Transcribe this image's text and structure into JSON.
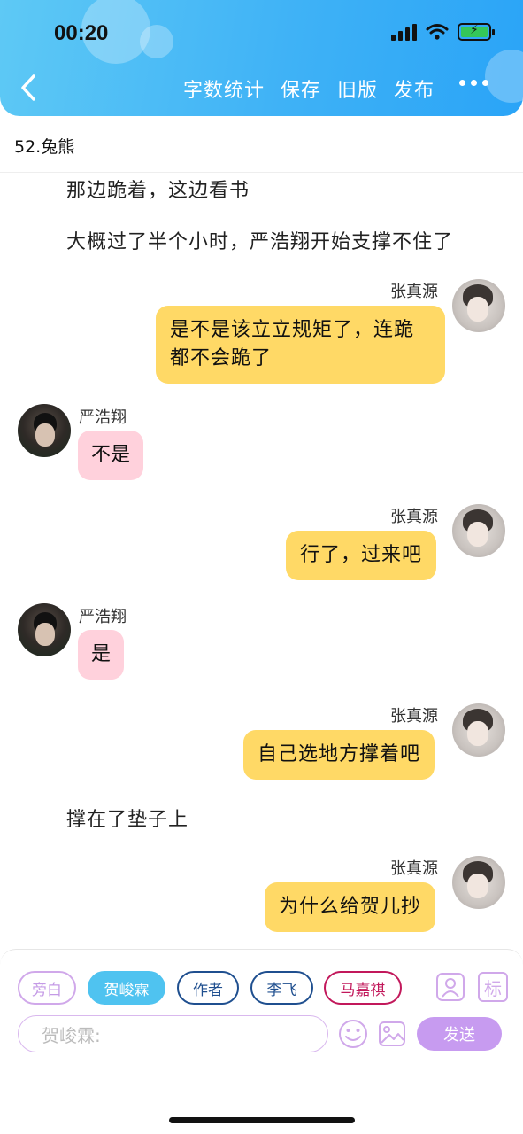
{
  "status": {
    "time": "00:20"
  },
  "header": {
    "actions": [
      "字数统计",
      "保存",
      "旧版",
      "发布"
    ]
  },
  "chapter": {
    "title": "52.兔熊"
  },
  "content": {
    "narration_1": "那边跪着，这边看书",
    "narration_2": "大概过了半个小时，严浩翔开始支撑不住了",
    "msg_1": {
      "speaker": "张真源",
      "line1": "是不是该立立规矩了，连跪",
      "line2": "都不会跪了"
    },
    "msg_2": {
      "speaker": "严浩翔",
      "text": "不是"
    },
    "msg_3": {
      "speaker": "张真源",
      "text": "行了，过来吧"
    },
    "msg_4": {
      "speaker": "严浩翔",
      "text": "是"
    },
    "msg_5": {
      "speaker": "张真源",
      "text": "自己选地方撑着吧"
    },
    "narration_3": "撑在了垫子上",
    "msg_6": {
      "speaker": "张真源",
      "text": "为什么给贺儿抄"
    }
  },
  "composer": {
    "roles": [
      {
        "label": "旁白",
        "color": "#d0a8ea",
        "selected": false
      },
      {
        "label": "贺峻霖",
        "color": "#4fc3f0",
        "selected": true
      },
      {
        "label": "作者",
        "color": "#1f4f8f",
        "selected": false
      },
      {
        "label": "李飞",
        "color": "#1f4f8f",
        "selected": false
      },
      {
        "label": "马嘉祺",
        "color": "#c2185b",
        "selected": false
      }
    ],
    "mark_label": "标",
    "placeholder": "贺峻霖:",
    "send_label": "发送"
  },
  "colors": {
    "header_gradient_start": "#5ec9f5",
    "header_gradient_end": "#2aa4f7",
    "my_bubble": "#ffd966",
    "other_bubble": "#ffd1dc",
    "send_button": "#c79bf0"
  }
}
